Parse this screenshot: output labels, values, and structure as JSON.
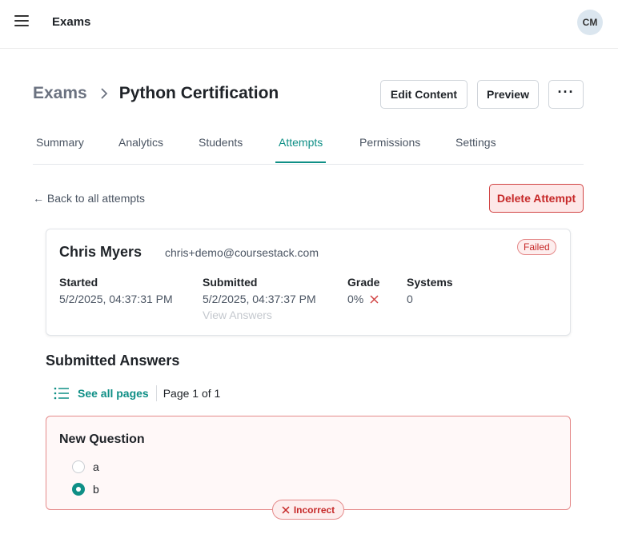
{
  "topbar": {
    "app_title": "Exams",
    "avatar_initials": "CM"
  },
  "breadcrumb": {
    "root": "Exams",
    "current": "Python Certification"
  },
  "header_actions": {
    "edit_label": "Edit Content",
    "preview_label": "Preview",
    "more_label": "···"
  },
  "tabs": [
    {
      "label": "Summary"
    },
    {
      "label": "Analytics"
    },
    {
      "label": "Students"
    },
    {
      "label": "Attempts",
      "active": true
    },
    {
      "label": "Permissions"
    },
    {
      "label": "Settings"
    }
  ],
  "attempt": {
    "back_label": "← Back to all attempts",
    "delete_label": "Delete Attempt",
    "student_name": "Chris Myers",
    "student_email": "chris+demo@coursestack.com",
    "status": "Failed",
    "started_label": "Started",
    "started_value": "5/2/2025, 04:37:31 PM",
    "submitted_label": "Submitted",
    "submitted_value": "5/2/2025, 04:37:37 PM",
    "view_answers_label": "View Answers",
    "grade_label": "Grade",
    "grade_value": "0%",
    "systems_label": "Systems",
    "systems_value": "0"
  },
  "answers": {
    "section_title": "Submitted Answers",
    "see_all_label": "See all pages",
    "page_indicator": "Page 1 of 1",
    "question": {
      "title": "New Question",
      "options": [
        {
          "label": "a",
          "selected": false
        },
        {
          "label": "b",
          "selected": true
        }
      ],
      "result": "Incorrect"
    }
  },
  "colors": {
    "accent": "#0f8f86",
    "danger": "#c62828",
    "danger_bg": "#fde8e8"
  }
}
